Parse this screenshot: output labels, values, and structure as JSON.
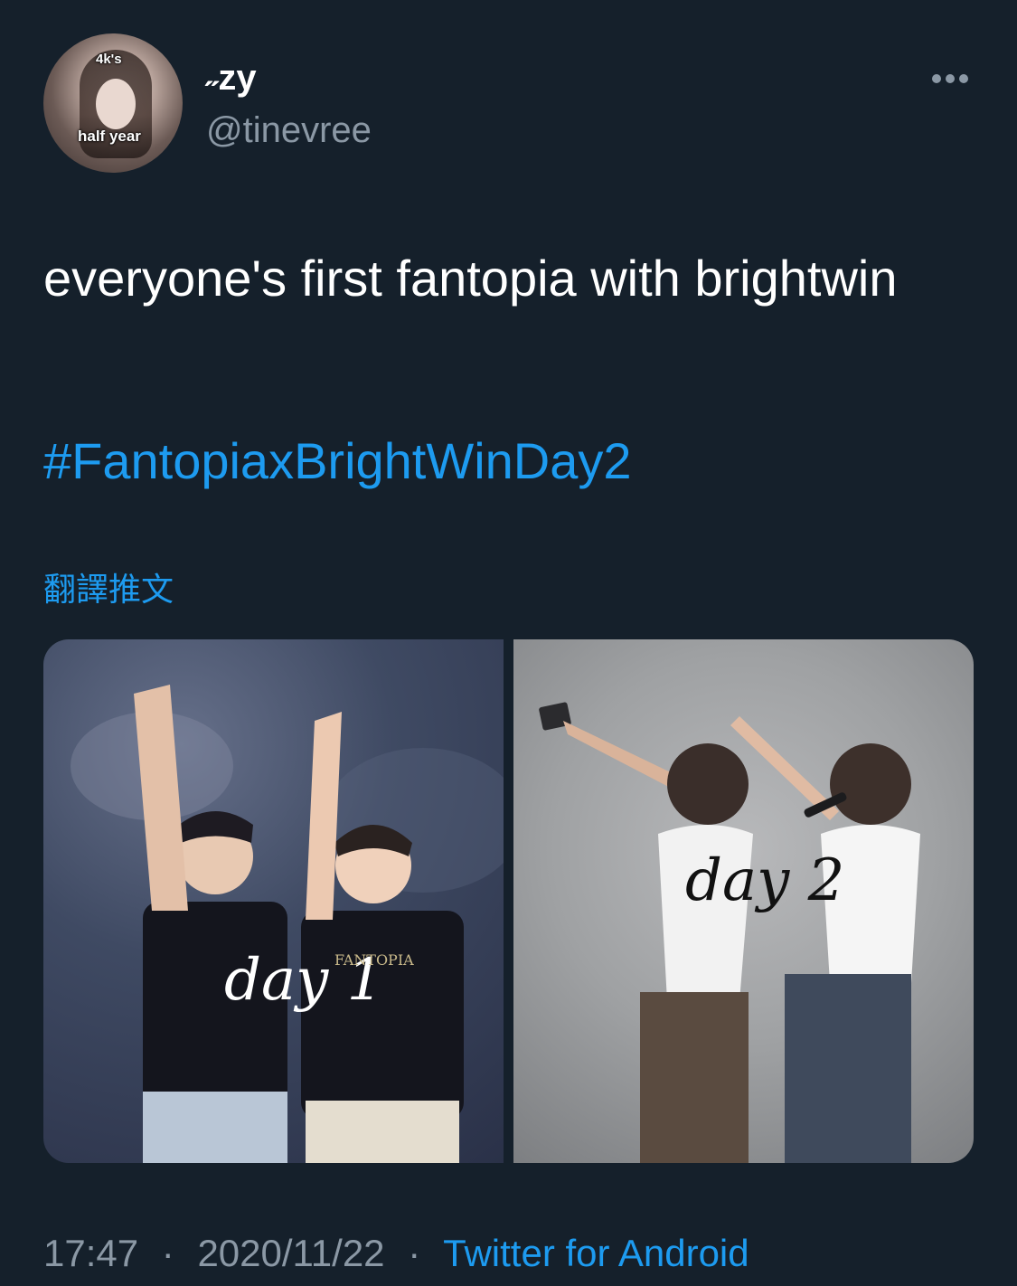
{
  "author": {
    "display_name": "˶zy",
    "handle": "@tinevree",
    "avatar": {
      "badge_top": "4k's",
      "badge_bottom": "half year"
    }
  },
  "more_icon": "more-horizontal-icon",
  "tweet": {
    "text": "everyone's first fantopia with brightwin",
    "hashtag": "#FantopiaxBrightWinDay2",
    "translate_label": "翻譯推文"
  },
  "media": {
    "photos": [
      {
        "caption": "day 1",
        "shirt_text": "FANTOPIA"
      },
      {
        "caption": "day 2"
      }
    ]
  },
  "meta": {
    "time": "17:47",
    "separator": "·",
    "date": "2020/11/22",
    "source": "Twitter for Android"
  },
  "colors": {
    "background": "#15202b",
    "link": "#1d9bf0",
    "secondary_text": "#8b98a5",
    "primary_text": "#ffffff"
  }
}
